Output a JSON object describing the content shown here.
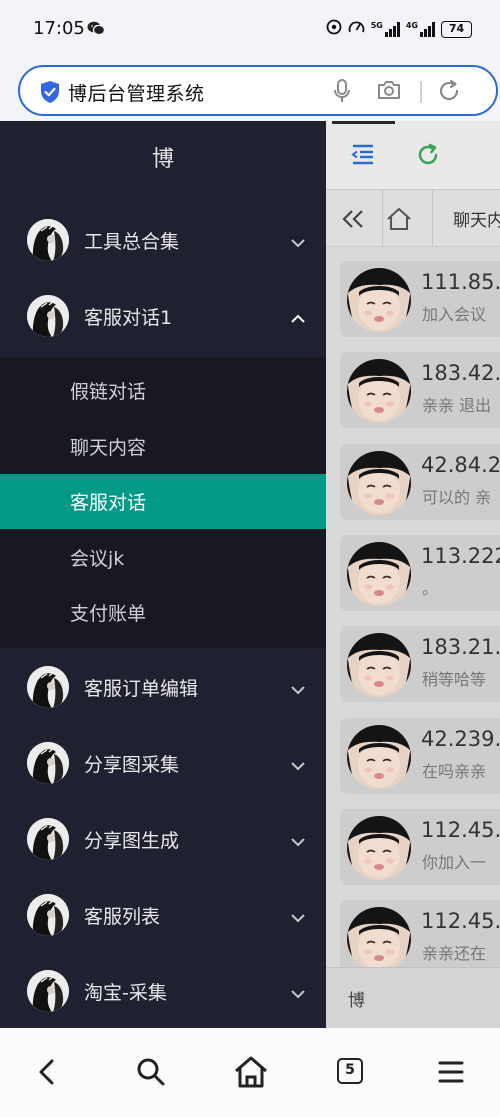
{
  "status_bar": {
    "time": "17:05",
    "network_5g": "5G",
    "network_4g": "4G",
    "battery": "74"
  },
  "browser": {
    "url_title": "博后台管理系统",
    "open_tabs": "5"
  },
  "sidebar": {
    "brand": "博",
    "menus": [
      {
        "label": "工具总合集",
        "expanded": false
      },
      {
        "label": "客服对话1",
        "expanded": true
      },
      {
        "label": "客服订单编辑",
        "expanded": false
      },
      {
        "label": "分享图采集",
        "expanded": false
      },
      {
        "label": "分享图生成",
        "expanded": false
      },
      {
        "label": "客服列表",
        "expanded": false
      },
      {
        "label": "淘宝-采集",
        "expanded": false
      }
    ],
    "submenu": [
      {
        "label": "假链对话"
      },
      {
        "label": "聊天内容"
      },
      {
        "label": "客服对话",
        "active": true
      },
      {
        "label": "会议jk"
      },
      {
        "label": "支付账单"
      }
    ],
    "active_color": "#009a86"
  },
  "content": {
    "tab_label": "聊天内",
    "chats": [
      {
        "ip": "111.85.",
        "msg": "加入会议"
      },
      {
        "ip": "183.42.",
        "msg": "亲亲 退出"
      },
      {
        "ip": "42.84.2",
        "msg": "可以的 亲"
      },
      {
        "ip": "113.222",
        "msg": "。"
      },
      {
        "ip": "183.21.",
        "msg": "稍等哈等"
      },
      {
        "ip": "42.239.",
        "msg": "在吗亲亲"
      },
      {
        "ip": "112.45.",
        "msg": "你加入一"
      },
      {
        "ip": "112.45.",
        "msg": "亲亲还在"
      }
    ],
    "footer": "博"
  },
  "colors": {
    "sidebar_bg": "#1f2030",
    "submenu_bg": "#171822",
    "accent_blue": "#2a69d8",
    "reload_green": "#3aa655"
  }
}
